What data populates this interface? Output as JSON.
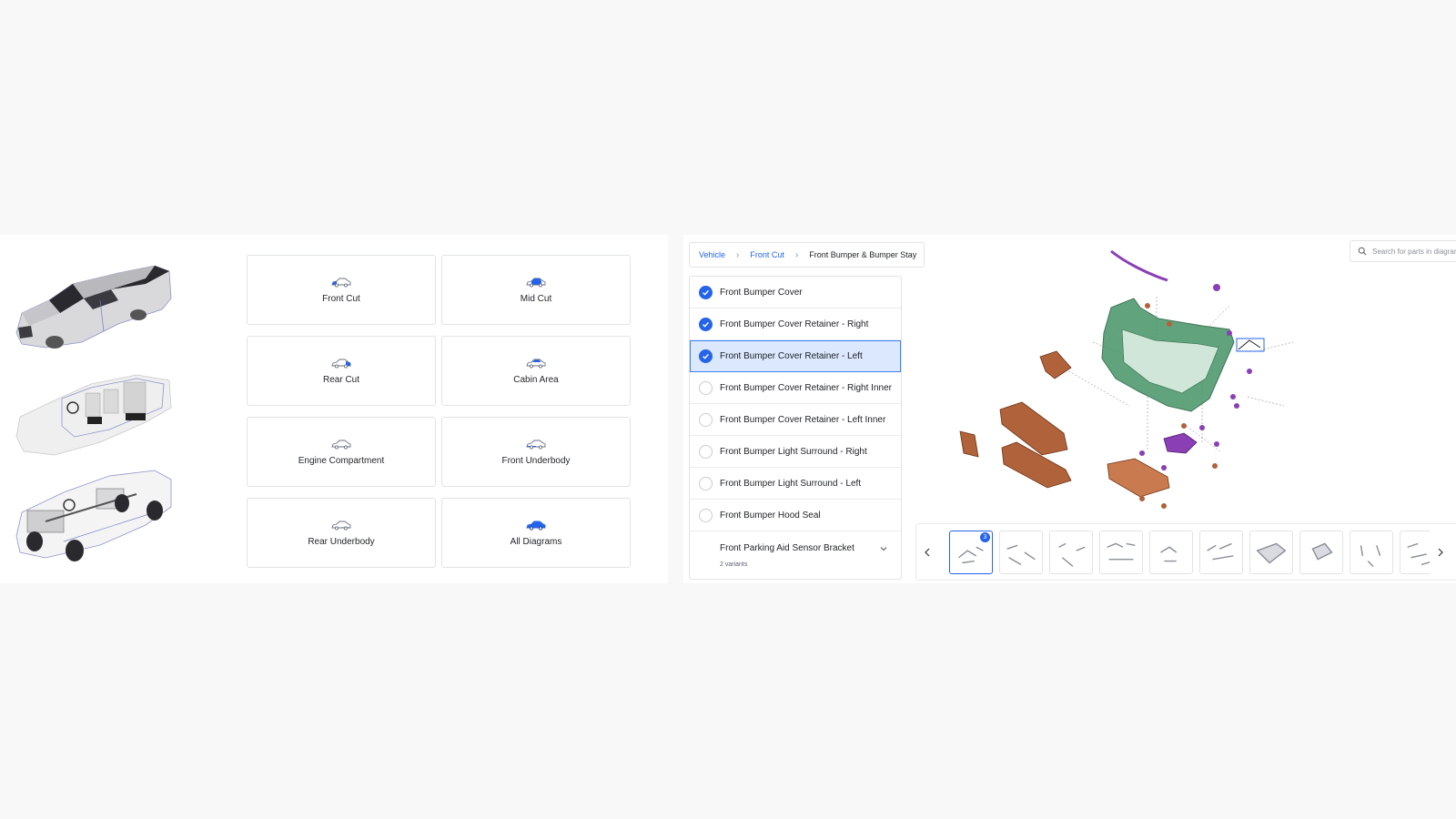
{
  "categories": [
    {
      "label": "Front Cut",
      "highlight": "front"
    },
    {
      "label": "Mid Cut",
      "highlight": "mid"
    },
    {
      "label": "Rear Cut",
      "highlight": "rear"
    },
    {
      "label": "Cabin Area",
      "highlight": "cabin"
    },
    {
      "label": "Engine Compartment",
      "highlight": "none"
    },
    {
      "label": "Front Underbody",
      "highlight": "under"
    },
    {
      "label": "Rear Underbody",
      "highlight": "under"
    },
    {
      "label": "All Diagrams",
      "highlight": "all"
    }
  ],
  "breadcrumb": {
    "vehicle": "Vehicle",
    "section": "Front Cut",
    "current": "Front Bumper & Bumper Stay"
  },
  "search": {
    "placeholder": "Search for parts in diagram",
    "icon": "search-icon"
  },
  "parts": [
    {
      "name": "Front Bumper Cover",
      "checked": true,
      "selected": false
    },
    {
      "name": "Front Bumper Cover Retainer - Right",
      "checked": true,
      "selected": false
    },
    {
      "name": "Front Bumper Cover Retainer - Left",
      "checked": true,
      "selected": true
    },
    {
      "name": "Front Bumper Cover Retainer - Right Inner",
      "checked": false,
      "selected": false
    },
    {
      "name": "Front Bumper Cover Retainer - Left Inner",
      "checked": false,
      "selected": false
    },
    {
      "name": "Front Bumper Light Surround - Right",
      "checked": false,
      "selected": false
    },
    {
      "name": "Front Bumper Light Surround - Left",
      "checked": false,
      "selected": false
    },
    {
      "name": "Front Bumper Hood Seal",
      "checked": false,
      "selected": false
    }
  ],
  "multi_part": {
    "name": "Front Parking Aid Sensor Bracket",
    "variants": "2 variants"
  },
  "thumbnails": {
    "active_index": 0,
    "badge": "3",
    "count": 10
  },
  "colors": {
    "accent": "#2563eb",
    "part_green": "#4f9a6e",
    "part_brown": "#b0623a",
    "part_purple": "#8a3fb5"
  }
}
